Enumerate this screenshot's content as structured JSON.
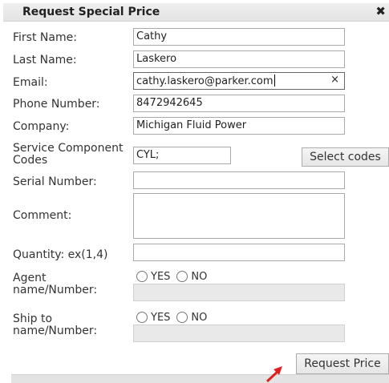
{
  "dialog": {
    "title": "Request Special Price",
    "close_icon": "close-icon"
  },
  "fields": {
    "first_name": {
      "label": "First Name:",
      "value": "Cathy"
    },
    "last_name": {
      "label": "Last Name:",
      "value": "Laskero"
    },
    "email": {
      "label": "Email:",
      "value": "cathy.laskero@parker.com"
    },
    "phone": {
      "label": "Phone Number:",
      "value": "8472942645"
    },
    "company": {
      "label": "Company:",
      "value": "Michigan Fluid Power"
    },
    "service_codes": {
      "label_line1": "Service Component",
      "label_line2": "Codes",
      "value": "CYL;"
    },
    "serial": {
      "label": "Serial Number:",
      "value": ""
    },
    "comment": {
      "label": "Comment:",
      "value": ""
    },
    "quantity": {
      "label": "Quantity: ex(1,4)",
      "value": ""
    },
    "agent": {
      "label_line1": "Agent",
      "label_line2": "name/Number:",
      "value": ""
    },
    "ship_to": {
      "label_line1": "Ship to",
      "label_line2": "name/Number:",
      "value": ""
    }
  },
  "radio": {
    "yes": "YES",
    "no": "NO"
  },
  "buttons": {
    "select_codes": "Select codes",
    "request_price": "Request Price"
  },
  "email_clear_icon": "×",
  "accent_arrow_color": "#e02020"
}
